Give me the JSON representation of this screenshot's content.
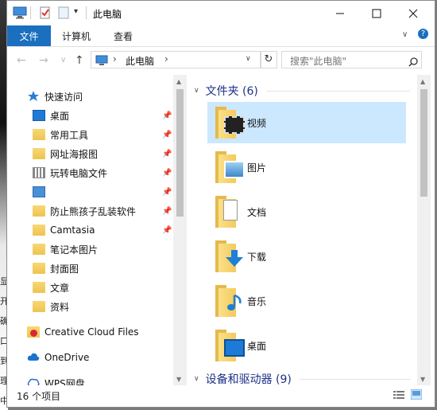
{
  "window": {
    "title": "此电脑"
  },
  "ribbon": {
    "tabs": [
      "文件",
      "计算机",
      "查看"
    ]
  },
  "address": {
    "path_root": "此电脑",
    "separator": "›"
  },
  "search": {
    "placeholder": "搜索\"此电脑\""
  },
  "nav": {
    "quick_access": "快速访问",
    "items": [
      {
        "label": "桌面",
        "icon": "desktop-icon",
        "pinned": true
      },
      {
        "label": "常用工具",
        "icon": "folder-icon",
        "pinned": true
      },
      {
        "label": "网址海报图",
        "icon": "folder-icon",
        "pinned": true
      },
      {
        "label": "玩转电脑文件",
        "icon": "grid-folder-icon",
        "pinned": true
      },
      {
        "label": "",
        "icon": "picture-icon",
        "pinned": true
      },
      {
        "label": "防止熊孩子乱装软件",
        "icon": "folder-icon",
        "pinned": true
      },
      {
        "label": "Camtasia",
        "icon": "folder-icon",
        "pinned": true
      },
      {
        "label": "笔记本图片",
        "icon": "folder-icon",
        "pinned": false
      },
      {
        "label": "封面图",
        "icon": "folder-icon",
        "pinned": false
      },
      {
        "label": "文章",
        "icon": "folder-icon",
        "pinned": false
      },
      {
        "label": "资料",
        "icon": "folder-icon",
        "pinned": false
      }
    ],
    "creative_cloud": "Creative Cloud Files",
    "onedrive": "OneDrive",
    "wps": "WPS网盘"
  },
  "main": {
    "folders_header": "文件夹 (6)",
    "folders": [
      {
        "label": "视频",
        "icon": "video-folder-icon",
        "selected": true
      },
      {
        "label": "图片",
        "icon": "pictures-folder-icon",
        "selected": false
      },
      {
        "label": "文档",
        "icon": "documents-folder-icon",
        "selected": false
      },
      {
        "label": "下载",
        "icon": "downloads-folder-icon",
        "selected": false
      },
      {
        "label": "音乐",
        "icon": "music-folder-icon",
        "selected": false
      },
      {
        "label": "桌面",
        "icon": "desktop-folder-icon",
        "selected": false
      }
    ],
    "devices_header": "设备和驱动器 (9)"
  },
  "status": {
    "count": "16 个项目"
  },
  "colors": {
    "accent": "#1a6fbf",
    "header": "#1e3287",
    "selected": "#cce8ff"
  }
}
